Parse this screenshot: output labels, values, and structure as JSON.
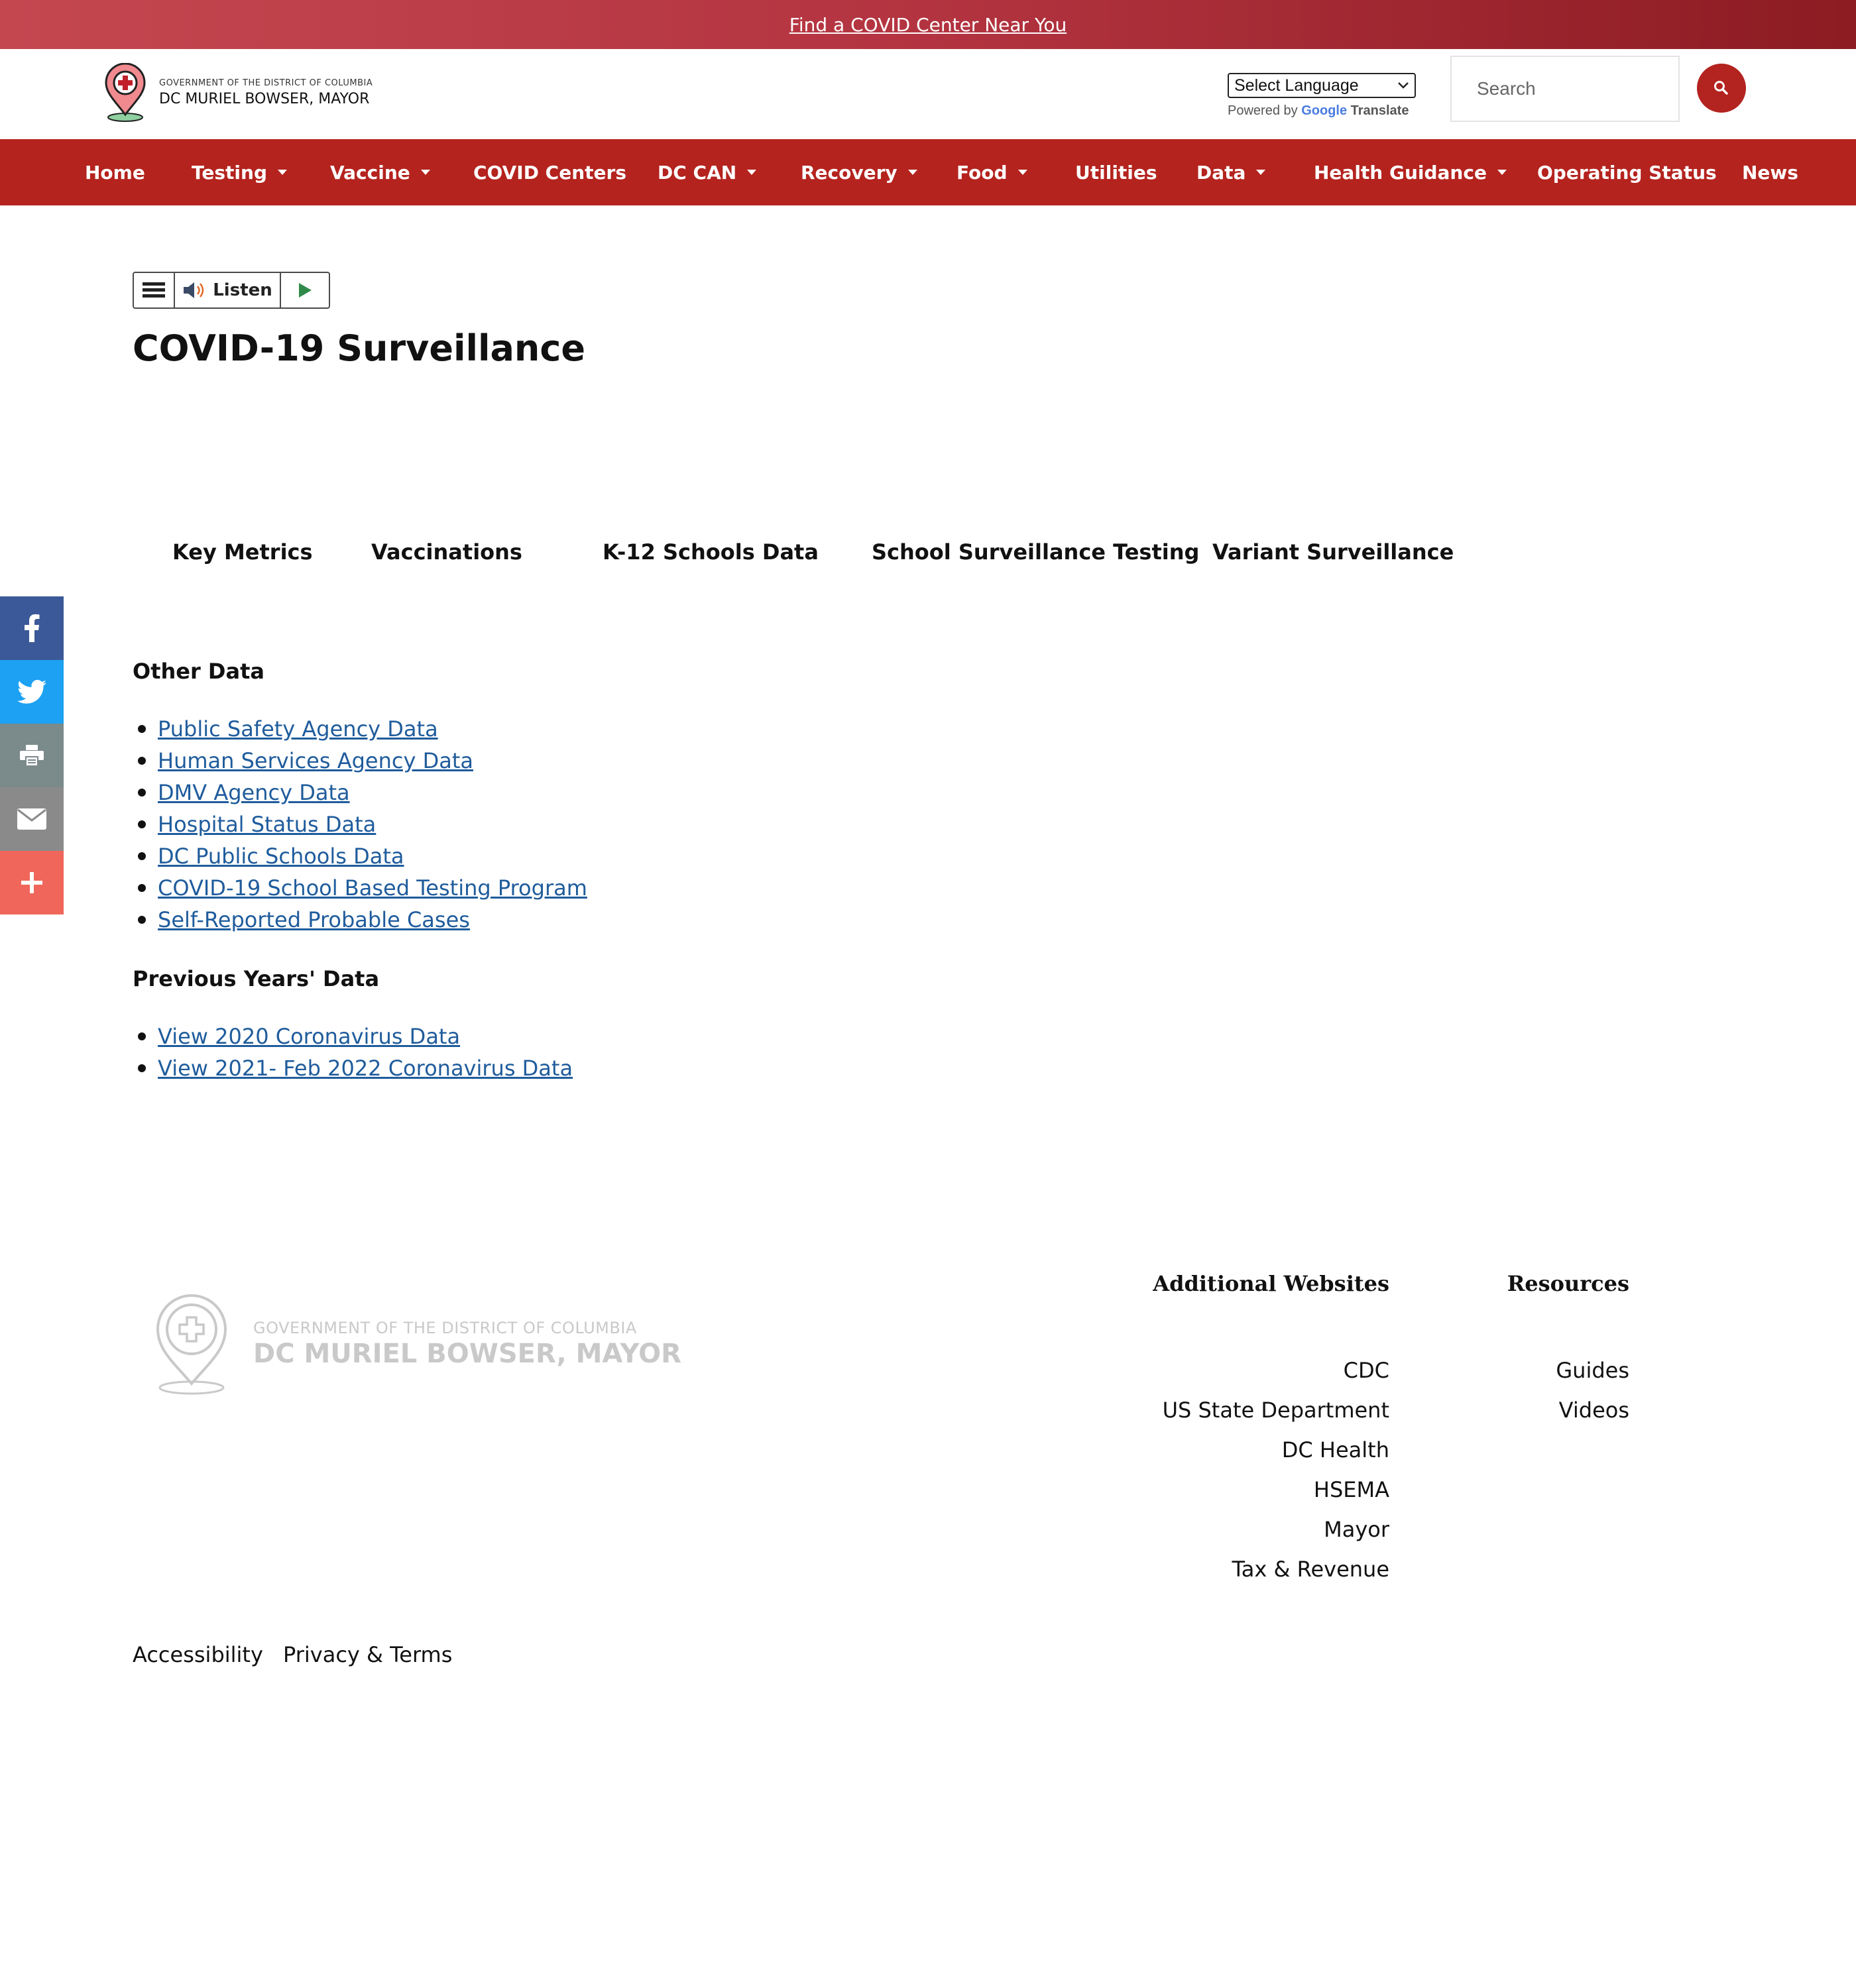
{
  "banner": {
    "link": "Find a COVID Center Near You"
  },
  "header": {
    "logo": {
      "gov_line": "GOVERNMENT OF THE DISTRICT OF COLUMBIA",
      "mayor_line": "MURIEL BOWSER, MAYOR",
      "dc": "DC"
    },
    "language_select": "Select Language",
    "powered_by": "Powered by",
    "google": "Google",
    "translate": "Translate",
    "search_placeholder": "Search"
  },
  "nav": [
    {
      "label": "Home",
      "caret": false
    },
    {
      "label": "Testing",
      "caret": true
    },
    {
      "label": "Vaccine",
      "caret": true
    },
    {
      "label": "COVID Centers",
      "caret": false
    },
    {
      "label": "DC CAN",
      "caret": true
    },
    {
      "label": "Recovery",
      "caret": true
    },
    {
      "label": "Food",
      "caret": true
    },
    {
      "label": "Utilities",
      "caret": false
    },
    {
      "label": "Data",
      "caret": true
    },
    {
      "label": "Health Guidance",
      "caret": true
    },
    {
      "label": "Operating Status",
      "caret": false
    },
    {
      "label": "News",
      "caret": false
    }
  ],
  "listen": {
    "label": "Listen"
  },
  "page_title": "COVID-19 Surveillance",
  "tabs": [
    "Key Metrics",
    "Vaccinations",
    "K-12 Schools Data",
    "School Surveillance Testing",
    "Variant Surveillance"
  ],
  "other_data": {
    "heading": "Other Data",
    "links": [
      "Public Safety Agency Data",
      "Human Services Agency Data",
      "DMV Agency Data",
      "Hospital Status Data",
      "DC Public Schools Data",
      "COVID-19 School Based Testing Program",
      "Self-Reported Probable Cases"
    ]
  },
  "previous_data": {
    "heading": "Previous Years' Data",
    "links": [
      "View 2020 Coronavirus Data",
      "View 2021- Feb 2022 Coronavirus Data"
    ]
  },
  "social": [
    "facebook-icon",
    "twitter-icon",
    "print-icon",
    "email-icon",
    "plus-icon"
  ],
  "colors": {
    "facebook": "#3b5998",
    "twitter": "#1da1f2",
    "print": "#7b8a8b",
    "email": "#8a8a8a",
    "share": "#f0665a",
    "nav": "#b4231e"
  },
  "footer": {
    "logo": {
      "gov_line": "GOVERNMENT OF THE DISTRICT OF COLUMBIA",
      "mayor_line": "MURIEL BOWSER, MAYOR",
      "dc": "DC"
    },
    "additional": {
      "heading": "Additional Websites",
      "links": [
        "CDC",
        "US State Department",
        "DC Health",
        "HSEMA",
        "Mayor",
        "Tax & Revenue"
      ]
    },
    "resources": {
      "heading": "Resources",
      "links": [
        "Guides",
        "Videos"
      ]
    },
    "bottom": [
      "Accessibility",
      "Privacy & Terms"
    ]
  }
}
